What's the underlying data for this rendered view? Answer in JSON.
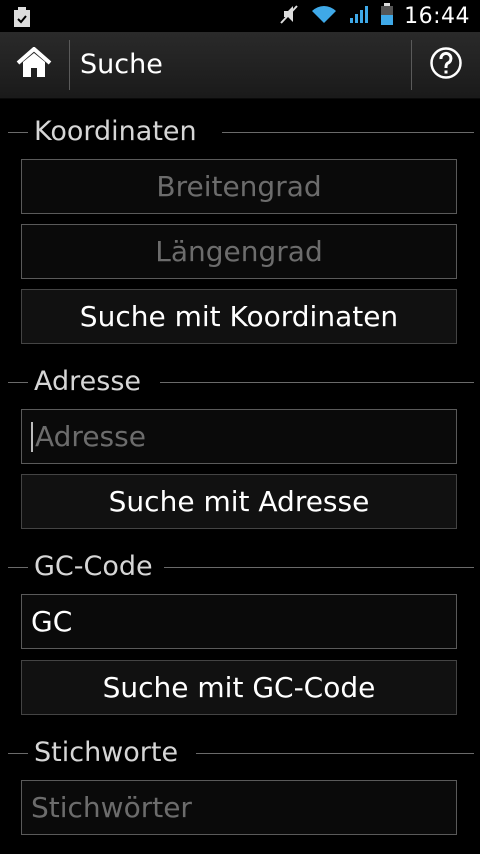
{
  "statusbar": {
    "time": "16:44",
    "icons": [
      "clipboard-icon",
      "mute-icon",
      "wifi-icon",
      "signal-icon",
      "battery-icon"
    ]
  },
  "actionbar": {
    "title": "Suche",
    "home_icon": "home-icon",
    "help_icon": "help-icon"
  },
  "sections": {
    "coords": {
      "title": "Koordinaten",
      "latitude_placeholder": "Breitengrad",
      "longitude_placeholder": "Längengrad",
      "search_button": "Suche mit Koordinaten"
    },
    "address": {
      "title": "Adresse",
      "placeholder": "Adresse",
      "search_button": "Suche mit Adresse"
    },
    "gccode": {
      "title": "GC-Code",
      "value": "GC",
      "search_button": "Suche mit GC-Code"
    },
    "keywords": {
      "title": "Stichworte",
      "placeholder": "Stichwörter"
    }
  }
}
